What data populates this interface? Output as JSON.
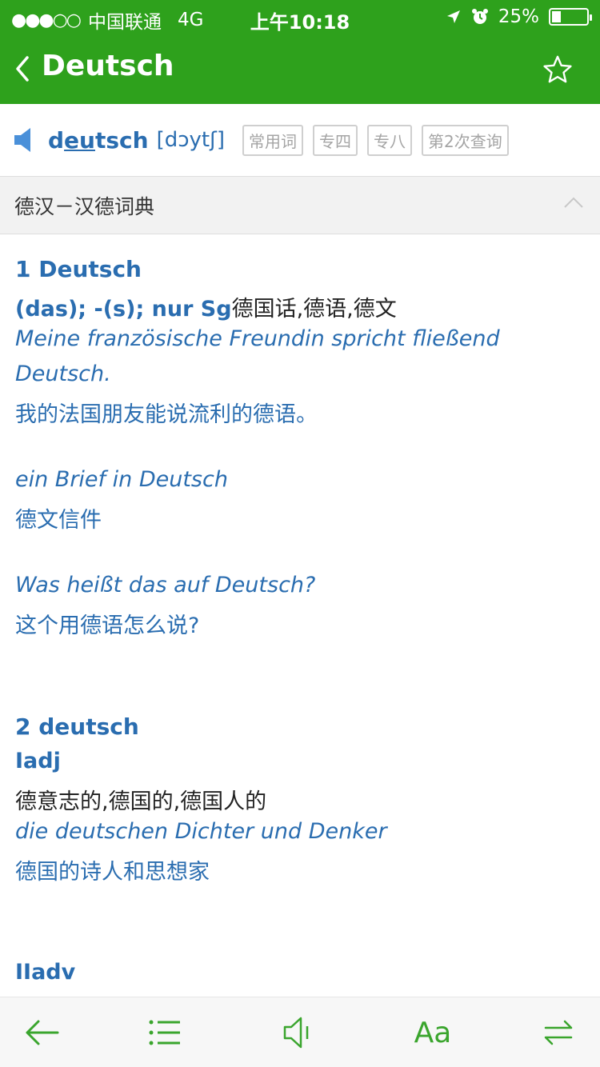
{
  "status": {
    "signal_dots": "●●●○○",
    "carrier": "中国联通",
    "network": "4G",
    "time": "上午10:18",
    "battery": "25%",
    "battery_level": 0.25
  },
  "nav": {
    "title": "Deutsch",
    "back_icon": "chevron-left-icon",
    "star_icon": "star-outline-icon"
  },
  "word": {
    "headword_pre": "d",
    "headword_stress": "eu",
    "headword_post": "tsch",
    "phonetic": "[dɔytʃ]",
    "tags": [
      "常用词",
      "专四",
      "专八",
      "第2次查询"
    ]
  },
  "section": {
    "title": "德汉－汉德词典",
    "toggle_icon": "chevron-up-icon"
  },
  "entries": {
    "e1_head": "1 Deutsch",
    "e1_gram": "(das); -(s); nur Sg",
    "e1_meaning": "德国话,德语,德文",
    "e1_ex1_de_line1": "Meine französische Freundin spricht fließend",
    "e1_ex1_de_line2": "Deutsch.",
    "e1_ex1_cn": "我的法国朋友能说流利的德语。",
    "e1_ex2_de": "ein Brief in Deutsch",
    "e1_ex2_cn": "德文信件",
    "e1_ex3_de": "Was heißt das auf Deutsch?",
    "e1_ex3_cn": "这个用德语怎么说?",
    "e2_head": "2 deutsch",
    "e2_gram": "Iadj",
    "e2_meaning": "德意志的,德国的,德国人的",
    "e2_ex1_de": "die deutschen Dichter und Denker",
    "e2_ex1_cn": "德国的诗人和思想家",
    "e2_gram2": "IIadv"
  },
  "toolbar": {
    "font_label": "Aa",
    "icons": [
      "back-arrow-icon",
      "list-icon",
      "speaker-icon",
      "font-size-icon",
      "swap-icon"
    ],
    "accent": "#3aa52d"
  },
  "colors": {
    "header_green": "#2ea11c",
    "link_blue": "#2a6db0"
  }
}
